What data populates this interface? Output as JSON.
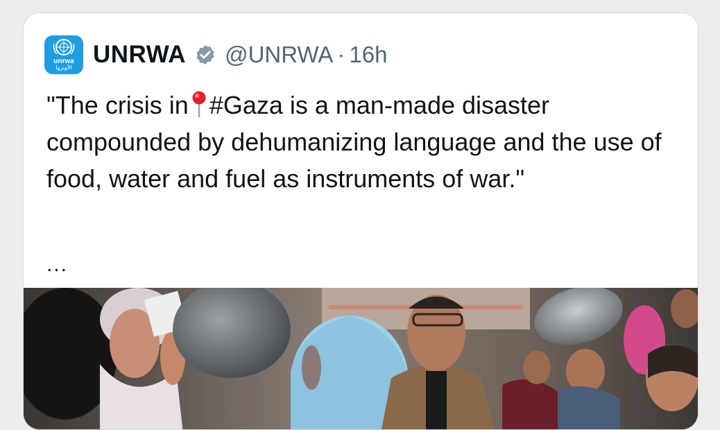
{
  "tweet": {
    "author_name": "UNRWA",
    "handle": "@UNRWA",
    "separator": "·",
    "time": "16h",
    "avatar_logo_text": "unrwa",
    "avatar_logo_text_ar": "الأونروا",
    "text_part1": "\"The crisis in",
    "text_part2": "#Gaza is a man-made disaster compounded by dehumanizing language and the use of food, water and fuel as instruments of war.\"",
    "more": "...",
    "icons": {
      "verified": "verified-badge-icon",
      "pin": "round-pushpin-icon"
    },
    "colors": {
      "brand_blue": "#1f9de0",
      "text": "#0f1419",
      "muted": "#536471",
      "pin_red": "#e0222a"
    }
  }
}
